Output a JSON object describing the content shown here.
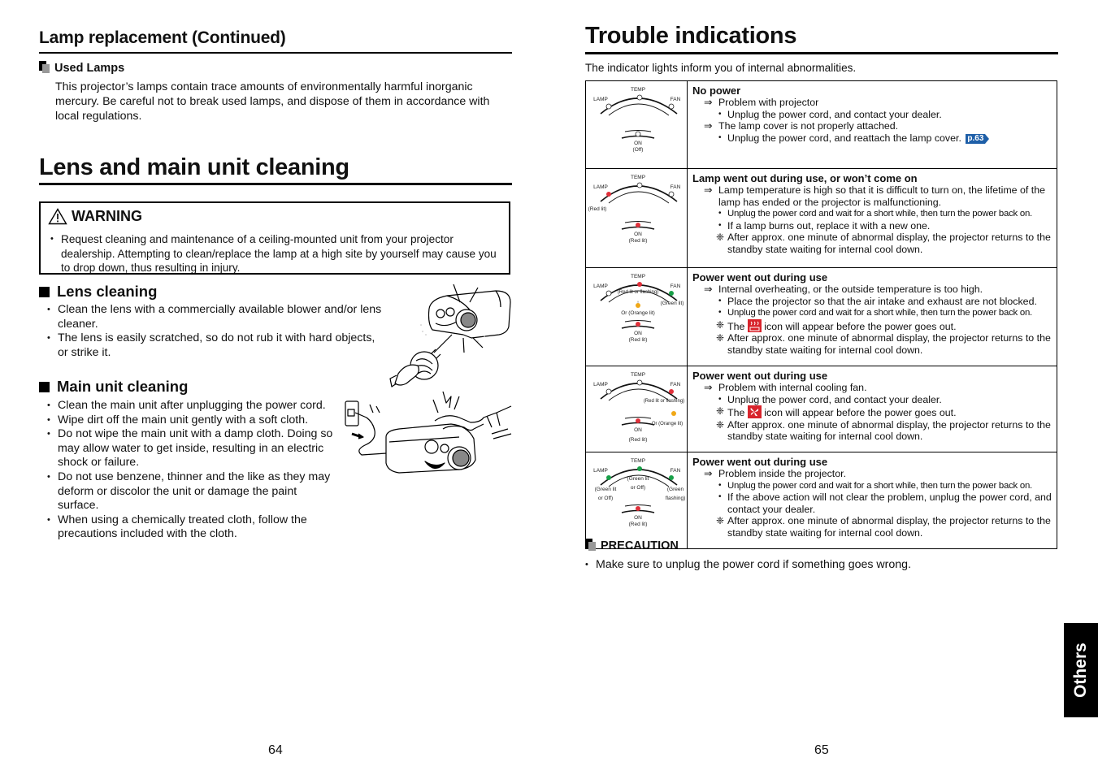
{
  "left_page": {
    "lamp_replacement": {
      "heading": "Lamp replacement (Continued)",
      "used_lamps": {
        "title": "Used Lamps",
        "text": "This projector’s lamps contain trace amounts of environmentally harmful inorganic mercury. Be careful not to break used lamps, and dispose of them in accordance with local regulations."
      }
    },
    "cleaning": {
      "heading": "Lens and main unit cleaning",
      "warning": {
        "title": "WARNING",
        "text": "Request cleaning and maintenance of a ceiling-mounted unit from your projector dealership. Attempting to clean/replace the lamp at a high site by yourself may cause you to drop down, thus resulting in injury."
      },
      "lens_cleaning": {
        "title": "Lens cleaning",
        "items": [
          "Clean the lens with a commercially available blower and/or lens cleaner.",
          "The lens is easily scratched, so do not rub it with hard objects, or strike it."
        ]
      },
      "main_unit_cleaning": {
        "title": "Main unit cleaning",
        "items": [
          "Clean the main unit after unplugging the power cord.",
          "Wipe dirt off the main unit gently with a soft cloth.",
          "Do not wipe the main unit with a damp cloth. Doing so may allow water to get inside, resulting in an electric shock or failure.",
          "Do not use benzene, thinner and the like as they may deform or discolor the unit or damage the paint surface.",
          "When using a chemically treated cloth, follow the precautions included with the cloth."
        ]
      }
    },
    "page_number": "64"
  },
  "right_page": {
    "heading": "Trouble indications",
    "intro": "The indicator lights inform you of internal abnormalities.",
    "indicator_labels": {
      "lamp": "LAMP",
      "temp": "TEMP",
      "fan": "FAN",
      "on": "ON"
    },
    "colors": {
      "red": "#e0303a",
      "green": "#18a048",
      "orange": "#f0a818",
      "link": "#1e5fa8"
    },
    "rows": [
      {
        "indicator": {
          "on_note": "(Off)"
        },
        "title": "No power",
        "lines": [
          {
            "type": "arrow",
            "text": "Problem with projector"
          },
          {
            "type": "bullet",
            "text": "Unplug the power cord, and contact your dealer."
          },
          {
            "type": "arrow",
            "text": "The lamp cover is not properly attached."
          },
          {
            "type": "bullet",
            "text": "Unplug the power cord, and reattach the lamp cover.",
            "page_ref": "p.63"
          }
        ]
      },
      {
        "indicator": {
          "lamp_note": "(Red lit)",
          "on_note": "(Red lit)"
        },
        "title": "Lamp went out during use, or won’t come on",
        "lines": [
          {
            "type": "arrow",
            "text": "Lamp temperature is high so that it is difficult to turn on, the lifetime of the lamp has ended or the projector is malfunctioning."
          },
          {
            "type": "bullet",
            "small": true,
            "text": "Unplug the power cord and wait for a short while, then turn the power back on."
          },
          {
            "type": "bullet",
            "text": "If a lamp burns out, replace it with a new one."
          },
          {
            "type": "star",
            "text": "After approx. one minute of abnormal display, the projector returns to the standby state waiting for internal cool down."
          }
        ]
      },
      {
        "indicator": {
          "temp_note": "(Red lit or flashing)",
          "fan_note": "(Green lit)",
          "alt_note": "Or (Orange lit)",
          "on_note": "(Red lit)"
        },
        "title": "Power went out during use",
        "lines": [
          {
            "type": "arrow",
            "text": "Internal overheating, or the outside temperature is too high."
          },
          {
            "type": "bullet",
            "text": "Place the projector so that the air intake and exhaust are not blocked."
          },
          {
            "type": "bullet",
            "small": true,
            "text": "Unplug the power cord and wait for a short while, then turn the power back on."
          },
          {
            "type": "star",
            "pre": "The",
            "icon": "overheat-icon",
            "text": "icon will appear before the power goes out."
          },
          {
            "type": "star",
            "text": "After approx. one minute of abnormal display, the projector returns to the standby state waiting for internal cool down."
          }
        ]
      },
      {
        "indicator": {
          "fan_note": "(Red lit or flashing)",
          "alt_note": "Or (Orange lit)",
          "on_note": "(Red lit)"
        },
        "title": "Power went out during use",
        "lines": [
          {
            "type": "arrow",
            "text": "Problem with internal cooling fan."
          },
          {
            "type": "bullet",
            "text": "Unplug the power cord, and contact your dealer."
          },
          {
            "type": "star",
            "pre": "The",
            "icon": "fan-warning-icon",
            "text": "icon will appear before the power goes out."
          },
          {
            "type": "star",
            "text": "After approx. one minute of abnormal display, the projector returns to the standby state waiting for internal cool down."
          }
        ]
      },
      {
        "indicator": {
          "lamp_note_1": "(Green lit",
          "lamp_note_2": "or Off)",
          "temp_note_1": "(Green lit",
          "temp_note_2": "or Off)",
          "fan_note_1": "(Green",
          "fan_note_2": "flashing)",
          "on_note": "(Red lit)"
        },
        "title": "Power went out during use",
        "lines": [
          {
            "type": "arrow",
            "text": "Problem inside the projector."
          },
          {
            "type": "bullet",
            "small": true,
            "text": "Unplug the power cord and wait for a short while, then turn the power back on."
          },
          {
            "type": "bullet",
            "text": "If the above action will not clear the problem, unplug  the power cord, and contact your dealer."
          },
          {
            "type": "star",
            "text": "After approx. one minute of abnormal display, the projector returns to the standby state waiting for internal cool down."
          }
        ]
      }
    ],
    "precaution": {
      "title": "PRECAUTION",
      "text": "Make sure to unplug the power cord if something goes wrong."
    },
    "side_tab": "Others",
    "page_number": "65"
  }
}
